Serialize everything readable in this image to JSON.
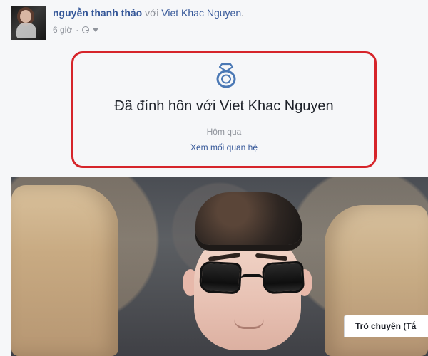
{
  "post": {
    "author": "nguyễn thanh thảo",
    "with_text": "với",
    "friend": "Viet Khac Nguyen",
    "period": ".",
    "time": "6 giờ",
    "separator": "·"
  },
  "event": {
    "title": "Đã đính hôn với Viet Khac Nguyen",
    "date": "Hôm qua",
    "link": "Xem mối quan hệ"
  },
  "chat": {
    "label": "Trò chuyện (Tắ"
  },
  "colors": {
    "background": "#f6f7f9",
    "link": "#365899",
    "muted": "#90949c",
    "highlight": "#d6252b"
  },
  "icons": {
    "clock": "clock-icon",
    "audience": "chevron-down-icon",
    "relationship": "ring-icon"
  }
}
